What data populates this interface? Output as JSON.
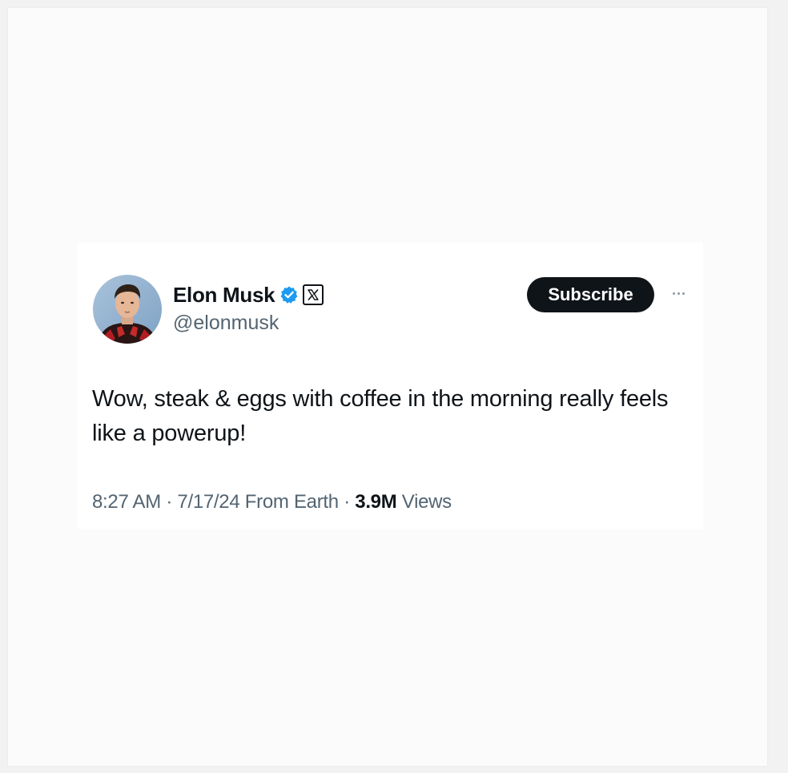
{
  "tweet": {
    "author": {
      "display_name": "Elon Musk",
      "handle": "@elonmusk",
      "verified_badge": "verified-check-icon",
      "affiliate_badge": "x-logo-icon"
    },
    "subscribe_label": "Subscribe",
    "more_icon": "more-horizontal-icon",
    "text": "Wow, steak & eggs with coffee in the morning really feels like a powerup!",
    "meta": {
      "time": "8:27 AM",
      "separator": "·",
      "date": "7/17/24",
      "source": "From Earth",
      "views_count": "3.9M",
      "views_label": "Views"
    }
  },
  "colors": {
    "text_primary": "#0f1419",
    "text_secondary": "#536471",
    "verified_blue": "#1d9bf0",
    "button_bg": "#0f1419",
    "card_bg": "#ffffff",
    "page_bg": "#fbfbfb"
  }
}
